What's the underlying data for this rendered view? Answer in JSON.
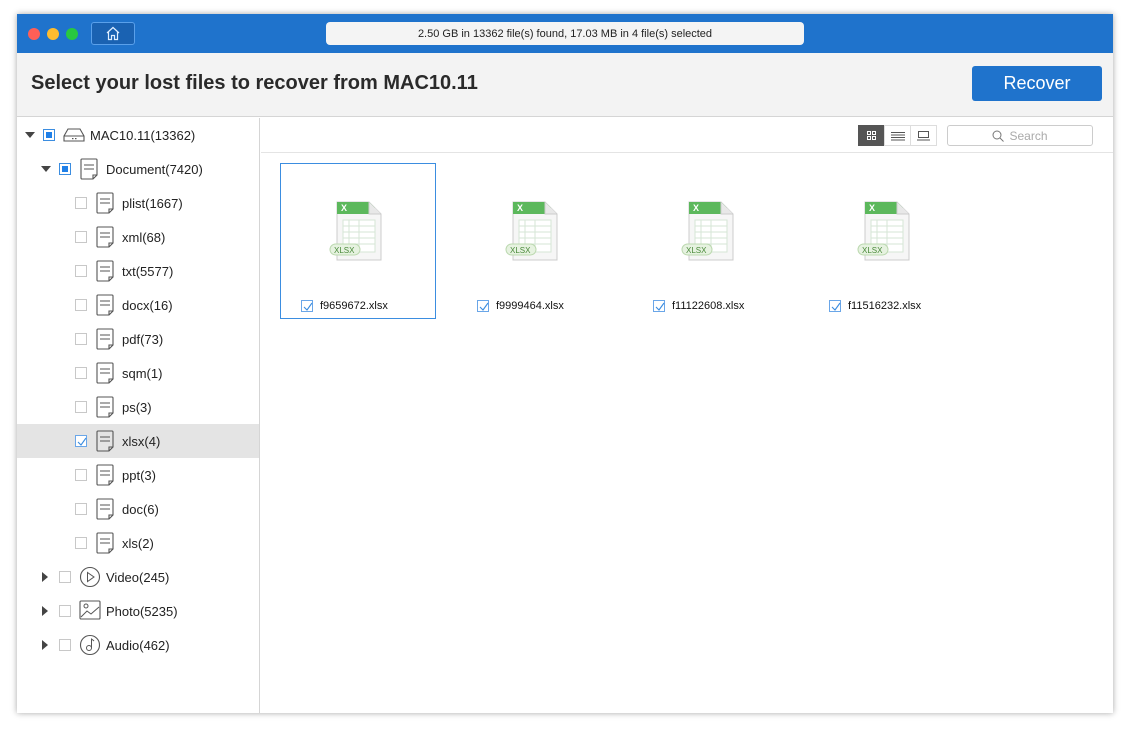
{
  "titlebar": {
    "status": "2.50 GB in 13362 file(s) found, 17.03 MB in 4 file(s) selected"
  },
  "header": {
    "title": "Select your lost files to recover from MAC10.11",
    "recover_label": "Recover"
  },
  "tree": [
    {
      "label": "MAC10.11(13362)",
      "level": 0,
      "expanded": true,
      "state": "partial",
      "icon": "drive"
    },
    {
      "label": "Document(7420)",
      "level": 1,
      "expanded": true,
      "state": "partial",
      "icon": "document"
    },
    {
      "label": "plist(1667)",
      "level": 2,
      "state": "none",
      "icon": "document"
    },
    {
      "label": "xml(68)",
      "level": 2,
      "state": "none",
      "icon": "document"
    },
    {
      "label": "txt(5577)",
      "level": 2,
      "state": "none",
      "icon": "document"
    },
    {
      "label": "docx(16)",
      "level": 2,
      "state": "none",
      "icon": "document"
    },
    {
      "label": "pdf(73)",
      "level": 2,
      "state": "none",
      "icon": "document"
    },
    {
      "label": "sqm(1)",
      "level": 2,
      "state": "none",
      "icon": "document"
    },
    {
      "label": "ps(3)",
      "level": 2,
      "state": "none",
      "icon": "document"
    },
    {
      "label": "xlsx(4)",
      "level": 2,
      "state": "checked",
      "icon": "document",
      "selected": true
    },
    {
      "label": "ppt(3)",
      "level": 2,
      "state": "none",
      "icon": "document"
    },
    {
      "label": "doc(6)",
      "level": 2,
      "state": "none",
      "icon": "document"
    },
    {
      "label": "xls(2)",
      "level": 2,
      "state": "none",
      "icon": "document"
    },
    {
      "label": "Video(245)",
      "level": 1,
      "expanded": false,
      "state": "none",
      "icon": "video"
    },
    {
      "label": "Photo(5235)",
      "level": 1,
      "expanded": false,
      "state": "none",
      "icon": "photo"
    },
    {
      "label": "Audio(462)",
      "level": 1,
      "expanded": false,
      "state": "none",
      "icon": "audio"
    }
  ],
  "toolbar": {
    "search_placeholder": "Search",
    "active_view": "grid"
  },
  "files": [
    {
      "name": "f9659672.xlsx",
      "badge": "XLSX",
      "checked": true,
      "selected": true
    },
    {
      "name": "f9999464.xlsx",
      "badge": "XLSX",
      "checked": true
    },
    {
      "name": "f11122608.xlsx",
      "badge": "XLSX",
      "checked": true
    },
    {
      "name": "f11516232.xlsx",
      "badge": "XLSX",
      "checked": true
    }
  ],
  "colors": {
    "accent": "#1f73cc"
  }
}
